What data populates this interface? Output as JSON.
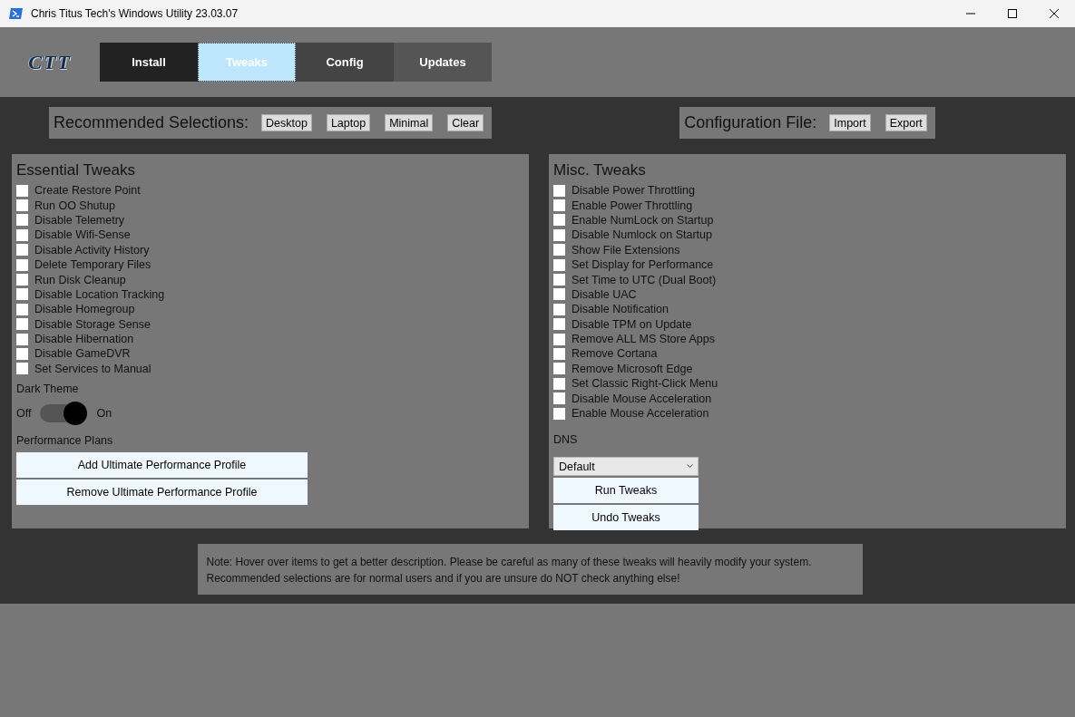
{
  "window": {
    "title": "Chris Titus Tech's Windows Utility 23.03.07"
  },
  "logo": "CTT",
  "tabs": [
    {
      "label": "Install",
      "selected": false
    },
    {
      "label": "Tweaks",
      "selected": true
    },
    {
      "label": "Config",
      "selected": false
    },
    {
      "label": "Updates",
      "selected": false
    }
  ],
  "recommended": {
    "label": "Recommended Selections:",
    "buttons": [
      "Desktop",
      "Laptop",
      "Minimal",
      "Clear"
    ]
  },
  "config_file": {
    "label": "Configuration File:",
    "buttons": [
      "Import",
      "Export"
    ]
  },
  "essential_tweaks": {
    "title": "Essential Tweaks",
    "items": [
      {
        "label": "Create Restore Point",
        "checked": false
      },
      {
        "label": "Run OO Shutup",
        "checked": false
      },
      {
        "label": "Disable Telemetry",
        "checked": false
      },
      {
        "label": "Disable Wifi-Sense",
        "checked": false
      },
      {
        "label": "Disable Activity History",
        "checked": false
      },
      {
        "label": "Delete Temporary Files",
        "checked": false
      },
      {
        "label": "Run Disk Cleanup",
        "checked": false
      },
      {
        "label": "Disable Location Tracking",
        "checked": false
      },
      {
        "label": "Disable Homegroup",
        "checked": false
      },
      {
        "label": "Disable Storage Sense",
        "checked": false
      },
      {
        "label": "Disable Hibernation",
        "checked": false
      },
      {
        "label": "Disable GameDVR",
        "checked": false
      },
      {
        "label": "Set Services to Manual",
        "checked": false
      }
    ],
    "dark_theme": {
      "label": "Dark Theme",
      "off_label": "Off",
      "on_label": "On",
      "on": true
    },
    "performance_plans": {
      "label": "Performance Plans",
      "buttons": [
        "Add Ultimate Performance Profile",
        "Remove Ultimate Performance Profile"
      ]
    }
  },
  "misc_tweaks": {
    "title": "Misc. Tweaks",
    "items": [
      {
        "label": "Disable Power Throttling",
        "checked": false
      },
      {
        "label": "Enable Power Throttling",
        "checked": false
      },
      {
        "label": "Enable NumLock on Startup",
        "checked": false
      },
      {
        "label": "Disable Numlock on Startup",
        "checked": false
      },
      {
        "label": "Show File Extensions",
        "checked": false
      },
      {
        "label": "Set Display for Performance",
        "checked": false
      },
      {
        "label": "Set Time to UTC (Dual Boot)",
        "checked": false
      },
      {
        "label": "Disable UAC",
        "checked": false
      },
      {
        "label": "Disable Notification",
        "checked": false
      },
      {
        "label": "Disable TPM on Update",
        "checked": false
      },
      {
        "label": "Remove ALL MS Store Apps",
        "checked": false
      },
      {
        "label": "Remove Cortana",
        "checked": false
      },
      {
        "label": "Remove Microsoft Edge",
        "checked": false
      },
      {
        "label": "Set Classic Right-Click Menu",
        "checked": false
      },
      {
        "label": "Disable Mouse Acceleration",
        "checked": false
      },
      {
        "label": "Enable Mouse Acceleration",
        "checked": false
      }
    ],
    "dns": {
      "label": "DNS",
      "value": "Default"
    },
    "buttons": [
      "Run Tweaks",
      "Undo Tweaks"
    ]
  },
  "note": "Note: Hover over items to get a better description. Please be careful as many of these tweaks will heavily modify your system.\nRecommended selections are for normal users and if you are unsure do NOT check anything else!"
}
